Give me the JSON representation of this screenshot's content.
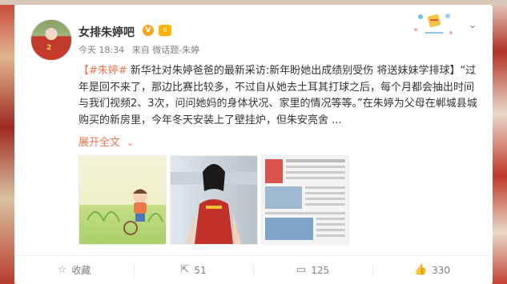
{
  "post": {
    "author": "女排朱婷吧",
    "verified_badge": "V",
    "level_badge": "6",
    "time": "今天 18:34",
    "source": "来自 微话题-朱婷",
    "avatar_number": "2",
    "text_topic": "【#朱婷#",
    "text_body": " 新华社对朱婷爸爸的最新采访:新年盼她出成绩别受伤 将送妹妹学排球】“过年是回不来了，那边比赛比较多，不过自从她去土耳其打球之后，每个月都会抽出时间与我们视频2、3次，问问她妈的身体状况、家里的情况等等。”在朱婷为父母在郸城县城购买的新房里，今年冬天安装上了壁挂炉，但朱安亮舍 ...",
    "expand_label": "展开全文",
    "chevron": "⌄"
  },
  "actions": {
    "favorite_label": "收藏",
    "repost_count": "51",
    "comment_count": "125",
    "like_count": "330"
  },
  "colors": {
    "accent": "#eb7350",
    "text": "#333333",
    "meta": "#808080"
  },
  "icons": [
    "star-icon",
    "repost-icon",
    "comment-icon",
    "like-icon",
    "chevron-down-icon",
    "verified-icon",
    "level-icon"
  ]
}
